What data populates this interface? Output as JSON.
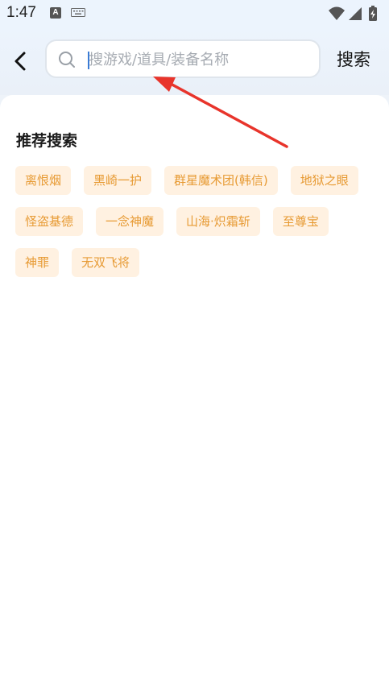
{
  "status_bar": {
    "time": "1:47",
    "notification_icons": [
      "a-icon",
      "keyboard-icon"
    ],
    "system_icons": [
      "wifi-icon",
      "signal-icon",
      "battery-charging-icon"
    ]
  },
  "header": {
    "back_icon": "chevron-left-icon",
    "search_placeholder": "搜游戏/道具/装备名称",
    "search_value": "",
    "search_button_label": "搜索"
  },
  "recommended": {
    "title": "推荐搜索",
    "tags": [
      "离恨烟",
      "黑崎一护",
      "群星魔术团(韩信)",
      "地狱之眼",
      "怪盗基德",
      "一念神魔",
      "山海·炽霜斩",
      "至尊宝",
      "神罪",
      "无双飞将"
    ]
  },
  "colors": {
    "tag_background": "#fff1e1",
    "tag_text": "#e79a33",
    "annotation_arrow": "#e8342b"
  }
}
